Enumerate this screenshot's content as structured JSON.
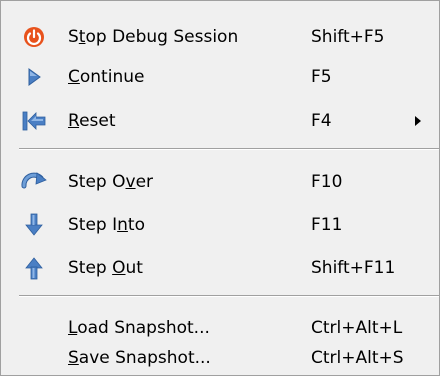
{
  "menu": {
    "items": [
      {
        "label_pre": "S",
        "mnemonic": "t",
        "label_post": "op Debug Session",
        "shortcut": "Shift+F5",
        "icon": "stop-debug-icon",
        "icon_color": "#e8521c"
      },
      {
        "label_pre": "",
        "mnemonic": "C",
        "label_post": "ontinue",
        "shortcut": "F5",
        "icon": "continue-icon",
        "icon_color": "#4a7fc4"
      },
      {
        "label_pre": "",
        "mnemonic": "R",
        "label_post": "eset",
        "shortcut": "F4",
        "icon": "reset-icon",
        "icon_color": "#4a7fc4",
        "has_submenu": true
      },
      {
        "label_pre": "Step O",
        "mnemonic": "v",
        "label_post": "er",
        "shortcut": "F10",
        "icon": "step-over-icon",
        "icon_color": "#4a7fc4"
      },
      {
        "label_pre": "Step I",
        "mnemonic": "n",
        "label_post": "to",
        "shortcut": "F11",
        "icon": "step-into-icon",
        "icon_color": "#4a7fc4"
      },
      {
        "label_pre": "Step ",
        "mnemonic": "O",
        "label_post": "ut",
        "shortcut": "Shift+F11",
        "icon": "step-out-icon",
        "icon_color": "#4a7fc4"
      },
      {
        "label_pre": "",
        "mnemonic": "L",
        "label_post": "oad Snapshot...",
        "shortcut": "Ctrl+Alt+L",
        "icon": ""
      },
      {
        "label_pre": "",
        "mnemonic": "S",
        "label_post": "ave Snapshot...",
        "shortcut": "Ctrl+Alt+S",
        "icon": ""
      }
    ]
  }
}
